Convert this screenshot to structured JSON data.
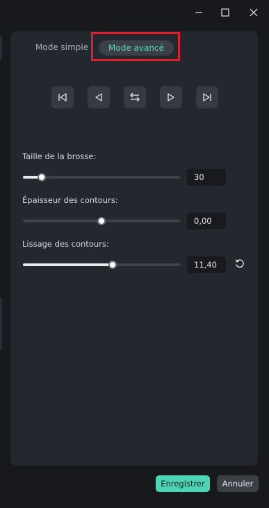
{
  "window": {
    "controls": [
      "minimize-icon",
      "maximize-icon",
      "close-icon"
    ]
  },
  "modes": {
    "simple_label": "Mode simple",
    "advanced_label": "Mode avancé",
    "active": "advanced",
    "accent_color": "#5ad8c1",
    "highlight_color": "#e01f2f"
  },
  "navigation": {
    "icons": [
      "skip-to-start-icon",
      "previous-icon",
      "swap-icon",
      "next-icon",
      "skip-to-end-icon"
    ]
  },
  "settings": [
    {
      "label": "Taille de la brosse:",
      "value_text": "30",
      "level": 0.12
    },
    {
      "label": "Épaisseur des contours:",
      "value_text": "0,00",
      "level": 0.5
    },
    {
      "label": "Lissage des contours:",
      "value_text": "11,40",
      "level": 0.57,
      "reset_icon": "reset-icon"
    }
  ],
  "footer": {
    "save_label": "Enregistrer",
    "cancel_label": "Annuler",
    "save_color": "#4fd4b7"
  }
}
